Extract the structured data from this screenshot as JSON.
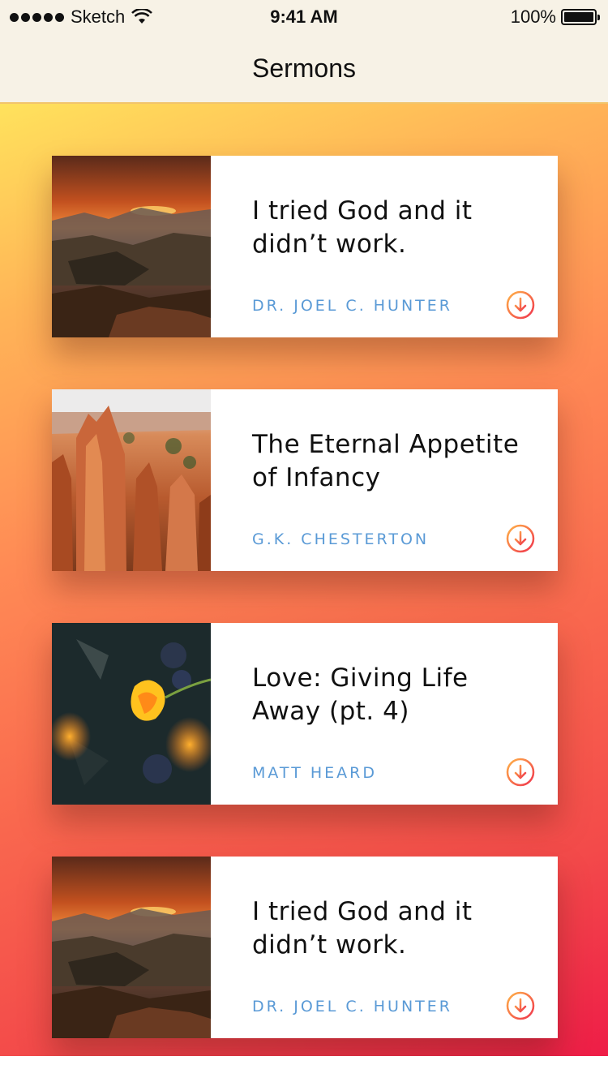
{
  "status_bar": {
    "carrier": "Sketch",
    "time": "9:41 AM",
    "battery": "100%"
  },
  "nav": {
    "title": "Sermons"
  },
  "sermons": [
    {
      "title": "I tried God and it didn’t work.",
      "author": "DR. JOEL C. HUNTER",
      "image_icon": "sunset-canyon-image"
    },
    {
      "title": "The Eternal Appetite of Infancy",
      "author": "G.K. CHESTERTON",
      "image_icon": "hoodoo-canyon-image"
    },
    {
      "title": "Love: Giving Life Away (pt. 4)",
      "author": "MATT HEARD",
      "image_icon": "tulip-flower-image"
    },
    {
      "title": "I tried God and it didn’t work.",
      "author": "DR. JOEL C. HUNTER",
      "image_icon": "sunset-canyon-image"
    }
  ],
  "colors": {
    "gradient_top": "#ffe25c",
    "gradient_bottom": "#ee1d47",
    "author_blue": "#5a9ad6",
    "download_orange": "#f46b4f"
  }
}
